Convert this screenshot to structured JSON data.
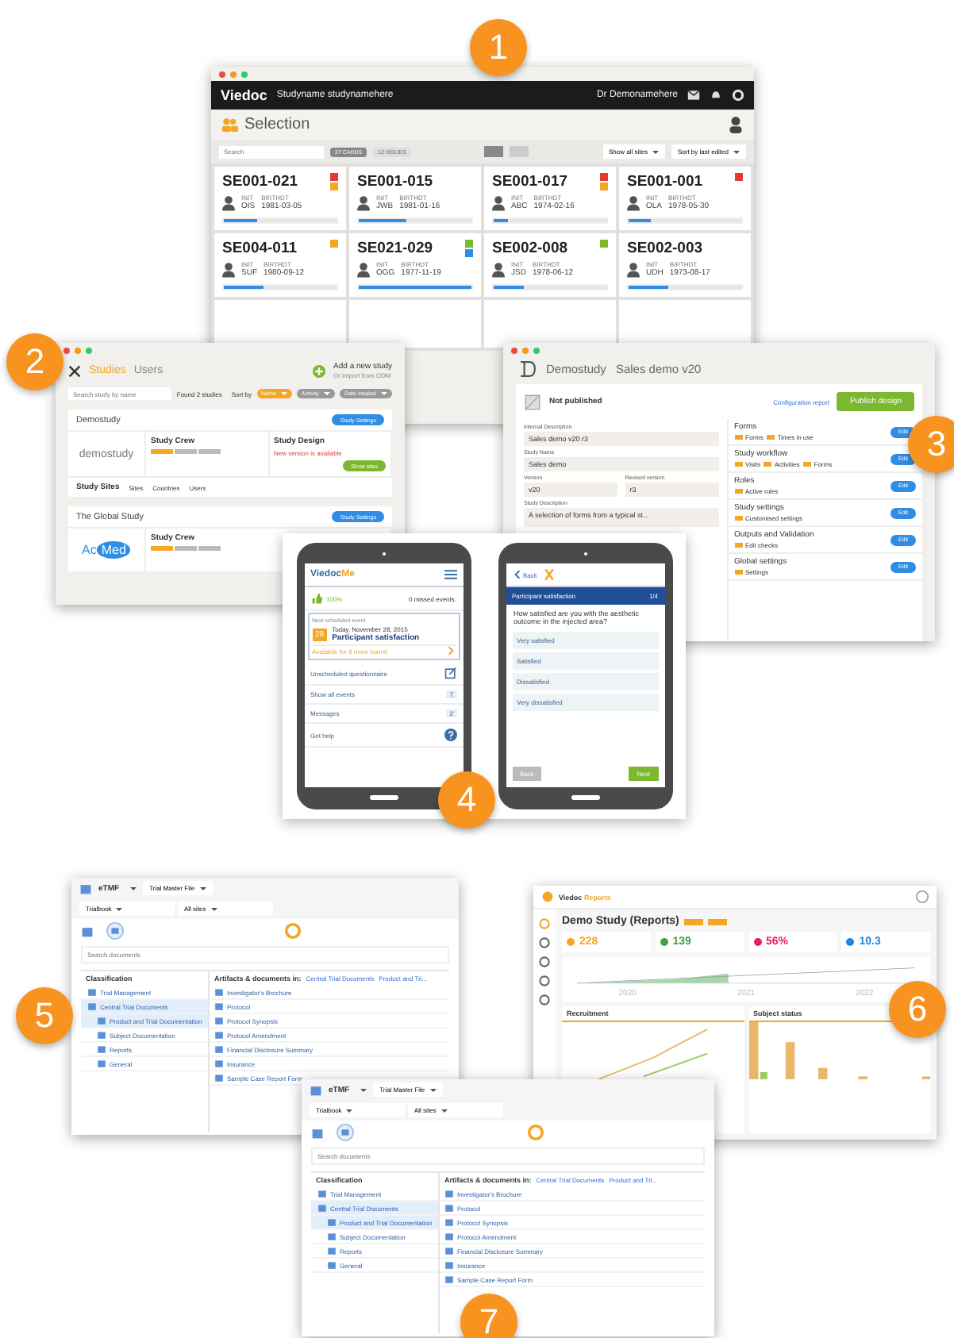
{
  "badges": [
    "1",
    "2",
    "3",
    "4",
    "5",
    "6",
    "7"
  ],
  "selection_window": {
    "logo": "Viedoc",
    "study": "Studyname studynamehere",
    "user": "Dr Demonamehere",
    "title": "Selection",
    "search": {
      "placeholder": "Search"
    },
    "count_buttons": [
      {
        "label": "27 CARDS",
        "selected": true
      },
      {
        "label": "12 ISSUES",
        "selected": false
      }
    ],
    "view_toggle": [
      {
        "selected": true
      },
      {
        "selected": false
      }
    ],
    "dropdowns": [
      "Show all sites",
      "Sort by last edited"
    ],
    "cards": [
      {
        "id": "SE001-021",
        "init_label": "INIT",
        "birth_label": "BIRTHDT",
        "initials": "OIS",
        "birthdate": "1981-03-05",
        "level": 0.3,
        "flags": [
          {
            "color": "#e53935"
          },
          {
            "color": "#f5a623"
          }
        ]
      },
      {
        "id": "SE001-015",
        "init_label": "INIT",
        "birth_label": "BIRTHDT",
        "initials": "JWB",
        "birthdate": "1981-01-16",
        "level": 0.42
      },
      {
        "id": "SE001-017",
        "init_label": "INIT",
        "birth_label": "BIRTHDT",
        "initials": "ABC",
        "birthdate": "1974-02-16",
        "level": 0.13,
        "flags": [
          {
            "color": "#e53935"
          },
          {
            "color": "#f5a623"
          }
        ]
      },
      {
        "id": "SE001-001",
        "init_label": "INIT",
        "birth_label": "BIRTHDT",
        "initials": "OLA",
        "birthdate": "1978-05-30",
        "level": 0.2,
        "flags": [
          {
            "color": "#e53935"
          }
        ]
      },
      {
        "id": "SE004-011",
        "init_label": "INIT",
        "birth_label": "BIRTHDT",
        "initials": "SUF",
        "birthdate": "1980-09-12",
        "level": 0.35,
        "flags": [
          {
            "color": "#f5a623"
          }
        ]
      },
      {
        "id": "SE021-029",
        "init_label": "INIT",
        "birth_label": "BIRTHDT",
        "initials": "OGG",
        "birthdate": "1977-11-19",
        "level": 1.0,
        "flags": [
          {
            "color": "#7cb82f"
          },
          {
            "color": "#2f8de4"
          }
        ]
      },
      {
        "id": "SE002-008",
        "init_label": "INIT",
        "birth_label": "BIRTHDT",
        "initials": "JSD",
        "birthdate": "1978-06-12",
        "level": 0.27,
        "flags": [
          {
            "color": "#7cb82f"
          }
        ]
      },
      {
        "id": "SE002-003",
        "init_label": "INIT",
        "birth_label": "BIRTHDT",
        "initials": "UDH",
        "birthdate": "1973-08-17",
        "level": 0.35
      }
    ]
  },
  "studies_window": {
    "tabs": [
      {
        "label": "Studies",
        "selected": true
      },
      {
        "label": "Users",
        "selected": false
      }
    ],
    "add_study": "Add a new study",
    "import": "Or import from ODM",
    "search": {
      "placeholder": "Search study by name"
    },
    "found": "Found 2 studies",
    "sort_label": "Sort by",
    "sort_buttons": [
      {
        "label": "Name",
        "selected": true
      },
      {
        "label": "Activity",
        "selected": false
      },
      {
        "label": "Date created",
        "selected": false
      }
    ],
    "studies": [
      {
        "name": "Demostudy",
        "settings": "Study Settings",
        "logo": {
          "kind": "wordmark",
          "text": "demostudy"
        },
        "crew_title": "Study Crew",
        "design_title": "Study Design",
        "design_note": "New version is available",
        "show_sites": "Show sites",
        "sites_title": "Study Sites",
        "site_stats": [
          "Sites",
          "Countries",
          "Users"
        ]
      },
      {
        "name": "The Global Study",
        "settings": "Study Settings",
        "logo": {
          "kind": "pill",
          "text": "Ac",
          "pill": "Med"
        },
        "crew_title": "Study Crew"
      }
    ]
  },
  "design_window": {
    "study": "Demostudy",
    "design": "Sales demo v20",
    "status": "Not published",
    "report": "Configuration report",
    "publish": "Publish design",
    "fields": [
      {
        "label": "Internal Description",
        "value": "Sales demo v20 r3"
      },
      {
        "label": "Study Name",
        "value": "Sales demo"
      }
    ],
    "versions": [
      {
        "label": "Version",
        "value": "v20"
      },
      {
        "label": "Revised version",
        "value": "r3"
      }
    ],
    "description": {
      "label": "Study Description",
      "value": "A selection of forms from a typical st..."
    },
    "sections": [
      {
        "title": "Forms",
        "tags": [
          "Forms",
          "Times in use"
        ],
        "button": "Edit"
      },
      {
        "title": "Study workflow",
        "tags": [
          "Visits",
          "Activities",
          "Forms"
        ],
        "button": "Edit"
      },
      {
        "title": "Roles",
        "tags": [
          "Active roles"
        ],
        "button": "Edit"
      },
      {
        "title": "Study settings",
        "tags": [
          "Customised settings"
        ],
        "button": "Edit"
      },
      {
        "title": "Outputs and Validation",
        "tags": [
          "Edit checks"
        ],
        "button": "Edit"
      },
      {
        "title": "Global settings",
        "tags": [
          "Settings"
        ],
        "button": "Edit"
      }
    ]
  },
  "phones": {
    "home": {
      "logo": "Viedoc",
      "logo_accent": "Me",
      "score": "100%",
      "missed": "0 missed events.",
      "next_label": "Next scheduled event",
      "day": "28",
      "date": "Today, November 28, 2015",
      "event": "Participant satisfaction",
      "available": "Available for 8 more hours!",
      "menu": [
        {
          "label": "Unscheduled questionnaire",
          "kind": "edit"
        },
        {
          "label": "Show all events",
          "kind": "count",
          "count": "7"
        },
        {
          "label": "Messages",
          "kind": "count",
          "count": "2"
        },
        {
          "label": "Get help",
          "kind": "help"
        }
      ]
    },
    "question": {
      "back": "Back",
      "title": "Participant satisfaction",
      "step": "1/4",
      "text": "How satisfied are you with the aesthetic outcome in the injected area?",
      "options": [
        {
          "label": "Very satisfied",
          "selected": false
        },
        {
          "label": "Satisfied",
          "selected": false
        },
        {
          "label": "Dissatisfied",
          "selected": false
        },
        {
          "label": "Very dissatisfied",
          "selected": false
        }
      ],
      "buttons": [
        {
          "label": "Back",
          "disabled": true
        },
        {
          "label": "Next",
          "disabled": false
        }
      ]
    }
  },
  "etmf_windows": [
    {
      "app": "eTMF",
      "file": "Trial Master File",
      "filters": [
        "Trialbook",
        "All sites"
      ],
      "search": {
        "placeholder": "Search documents"
      },
      "tree_title": "Classification",
      "path_label": "Artifacts & documents in:",
      "path": [
        "Central Trial Documents",
        "Product and Tri..."
      ],
      "tree": [
        {
          "label": "Trial Management",
          "selected": false
        },
        {
          "label": "Central Trial Documents",
          "selected": true,
          "children": [
            {
              "label": "Product and Trial Documentation",
              "selected": true
            },
            {
              "label": "Subject Documentation",
              "selected": false
            },
            {
              "label": "Reports",
              "selected": false
            },
            {
              "label": "General",
              "selected": false
            }
          ]
        }
      ],
      "docs": [
        "Investigator's Brochure",
        "Protocol",
        "Protocol Synopsis",
        "Protocol Amendment",
        "Financial Disclosure Summary",
        "Insurance",
        "Sample Case Report Form"
      ]
    },
    {
      "app": "eTMF",
      "file": "Trial Master File",
      "filters": [
        "Trialbook",
        "All sites"
      ],
      "search": {
        "placeholder": "Search documents"
      },
      "tree_title": "Classification",
      "path_label": "Artifacts & documents in:",
      "path": [
        "Central Trial Documents",
        "Product and Tri..."
      ],
      "tree": [
        {
          "label": "Trial Management",
          "selected": false
        },
        {
          "label": "Central Trial Documents",
          "selected": true,
          "children": [
            {
              "label": "Product and Trial Documentation",
              "selected": true
            },
            {
              "label": "Subject Documentation",
              "selected": false
            },
            {
              "label": "Reports",
              "selected": false
            },
            {
              "label": "General",
              "selected": false
            }
          ]
        }
      ],
      "docs": [
        "Investigator's Brochure",
        "Protocol",
        "Protocol Synopsis",
        "Protocol Amendment",
        "Financial Disclosure Summary",
        "Insurance",
        "Sample Case Report Form"
      ]
    }
  ],
  "reports_window": {
    "brand": "Viedoc",
    "brand_accent": "Reports",
    "title": "Demo Study (Reports)",
    "kpis": [
      {
        "value": "228",
        "color": "#f5a623"
      },
      {
        "value": "139",
        "color": "#43a047"
      },
      {
        "value": "56%",
        "color": "#e91e63"
      },
      {
        "value": "10.3",
        "color": "#1e88e5"
      }
    ],
    "years": [
      "2020",
      "2021",
      "2022"
    ],
    "panels": [
      "Recruitment",
      "Subject status"
    ]
  }
}
